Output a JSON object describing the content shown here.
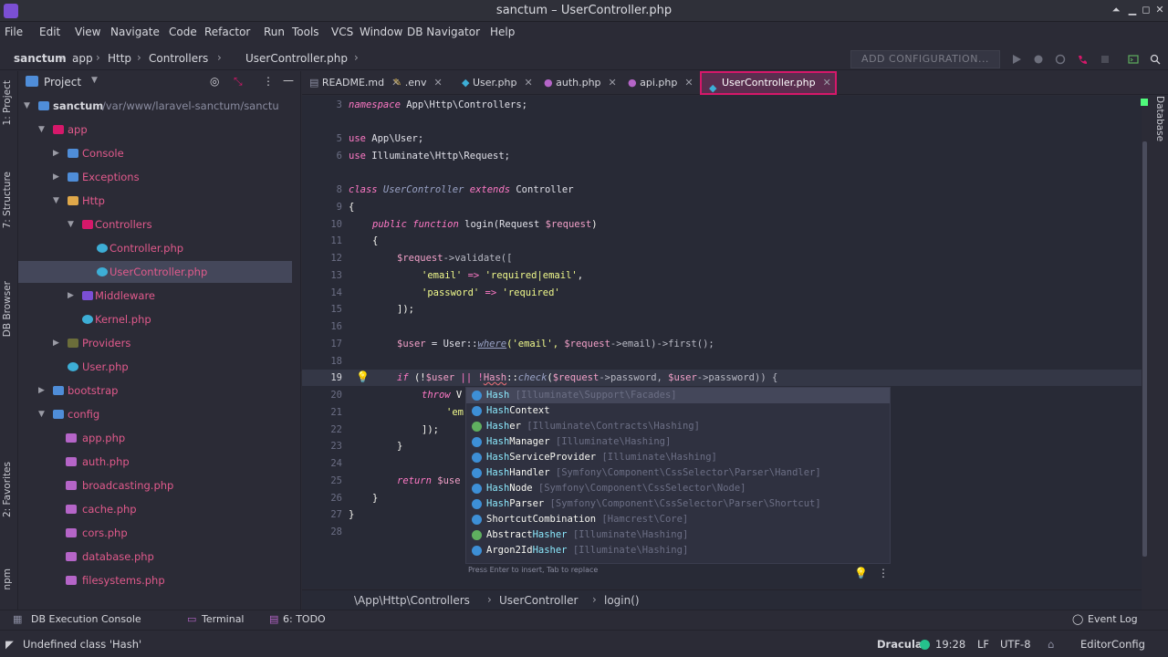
{
  "window": {
    "title": "sanctum – UserController.php"
  },
  "menu": [
    "File",
    "Edit",
    "View",
    "Navigate",
    "Code",
    "Refactor",
    "Run",
    "Tools",
    "VCS",
    "Window",
    "DB Navigator",
    "Help"
  ],
  "breadcrumbs": [
    "sanctum",
    "app",
    "Http",
    "Controllers",
    "UserController.php"
  ],
  "toolbar": {
    "add_config": "ADD CONFIGURATION..."
  },
  "left_tabs": {
    "project": "1: Project",
    "structure": "7: Structure",
    "db_browser": "DB Browser",
    "favorites": "2: Favorites",
    "npm": "npm"
  },
  "right_tabs": {
    "database": "Database"
  },
  "project": {
    "header": "Project",
    "tree": [
      {
        "label": "sanctum",
        "path": "/var/www/laravel-sanctum/sanctu"
      },
      {
        "label": "app"
      },
      {
        "label": "Console"
      },
      {
        "label": "Exceptions"
      },
      {
        "label": "Http"
      },
      {
        "label": "Controllers"
      },
      {
        "label": "Controller.php"
      },
      {
        "label": "UserController.php"
      },
      {
        "label": "Middleware"
      },
      {
        "label": "Kernel.php"
      },
      {
        "label": "Providers"
      },
      {
        "label": "User.php"
      },
      {
        "label": "bootstrap"
      },
      {
        "label": "config"
      },
      {
        "label": "app.php"
      },
      {
        "label": "auth.php"
      },
      {
        "label": "broadcasting.php"
      },
      {
        "label": "cache.php"
      },
      {
        "label": "cors.php"
      },
      {
        "label": "database.php"
      },
      {
        "label": "filesystems.php"
      }
    ]
  },
  "tabs": [
    "README.md",
    ".env",
    "User.php",
    "auth.php",
    "api.php",
    "UserController.php"
  ],
  "code": {
    "line_numbers": [
      "3",
      "",
      "5",
      "6",
      "",
      "8",
      "9",
      "10",
      "11",
      "12",
      "13",
      "14",
      "15",
      "16",
      "17",
      "18",
      "19",
      "20",
      "21",
      "22",
      "23",
      "24",
      "25",
      "26",
      "27",
      "28"
    ],
    "l3_a": "namespace",
    "l3_b": " App\\Http\\Controllers;",
    "l5_a": "use",
    "l5_b": " App\\User;",
    "l6_a": "use",
    "l6_b": " Illuminate\\Http\\Request;",
    "l8_a": "class",
    "l8_b": " UserController ",
    "l8_c": "extends",
    "l8_d": " Controller",
    "l9": "{",
    "l10_a": "public function",
    "l10_b": " login(Request ",
    "l10_c": "$request",
    "l10_d": ")",
    "l11": "{",
    "l12_a": "$request",
    "l12_b": "->validate([",
    "l13_a": "'email'",
    "l13_b": " => ",
    "l13_c": "'required|email'",
    "l13_d": ",",
    "l14_a": "'password'",
    "l14_b": " => ",
    "l14_c": "'required'",
    "l15": "]);",
    "l17_a": "$user",
    "l17_b": " = User::",
    "l17_c": "where",
    "l17_d": "('email', ",
    "l17_e": "$request",
    "l17_f": "->email)->first();",
    "l19_a": "if",
    "l19_b": " (!",
    "l19_c": "$user",
    "l19_d": " || !",
    "l19_e": "Hash",
    "l19_f": "::",
    "l19_g": "check",
    "l19_h": "(",
    "l19_i": "$request",
    "l19_j": "->password, ",
    "l19_k": "$user",
    "l19_l": "->password)) {",
    "l20_a": "throw",
    "l20_b": " V",
    "l21": "'em",
    "l22": "]);",
    "l23": "}",
    "l25_a": "return",
    "l25_b": " $use",
    "l26": "}",
    "l27": "}"
  },
  "completion": {
    "items": [
      {
        "match": "Hash",
        "rest": "",
        "pkg": " [Illuminate\\Support\\Facades]"
      },
      {
        "match": "Hash",
        "rest": "Context",
        "pkg": ""
      },
      {
        "match": "Hash",
        "rest": "er",
        "pkg": " [Illuminate\\Contracts\\Hashing]"
      },
      {
        "match": "Hash",
        "rest": "Manager",
        "pkg": " [Illuminate\\Hashing]"
      },
      {
        "match": "Hash",
        "rest": "ServiceProvider",
        "pkg": " [Illuminate\\Hashing]"
      },
      {
        "match": "Hash",
        "rest": "Handler",
        "pkg": " [Symfony\\Component\\CssSelector\\Parser\\Handler]"
      },
      {
        "match": "Hash",
        "rest": "Node",
        "pkg": " [Symfony\\Component\\CssSelector\\Node]"
      },
      {
        "match": "Hash",
        "rest": "Parser",
        "pkg": " [Symfony\\Component\\CssSelector\\Parser\\Shortcut]"
      },
      {
        "match": "",
        "rest": "ShortcutCombination",
        "pkg": " [Hamcrest\\Core]"
      },
      {
        "match": "Abstract",
        "rest": "Hasher",
        "pkg": " [Illuminate\\Hashing]"
      },
      {
        "match": "Argon2Id",
        "rest": "Hasher",
        "pkg": " [Illuminate\\Hashing]"
      }
    ],
    "footer": "Press Enter to insert, Tab to replace"
  },
  "editor_breadcrumbs": [
    "\\App\\Http\\Controllers",
    "UserController",
    "login()"
  ],
  "tool_windows": {
    "db_console": "DB Execution Console",
    "terminal": "Terminal",
    "todo": "6: TODO",
    "event_log": "Event Log"
  },
  "status": {
    "message": "Undefined class 'Hash'",
    "theme": "Dracula",
    "position": "19:28",
    "line_sep": "LF",
    "encoding": "UTF-8",
    "editorconfig": "EditorConfig"
  },
  "colors": {
    "accent": "#d6186a",
    "selection": "#44475a",
    "background": "#282a36"
  }
}
